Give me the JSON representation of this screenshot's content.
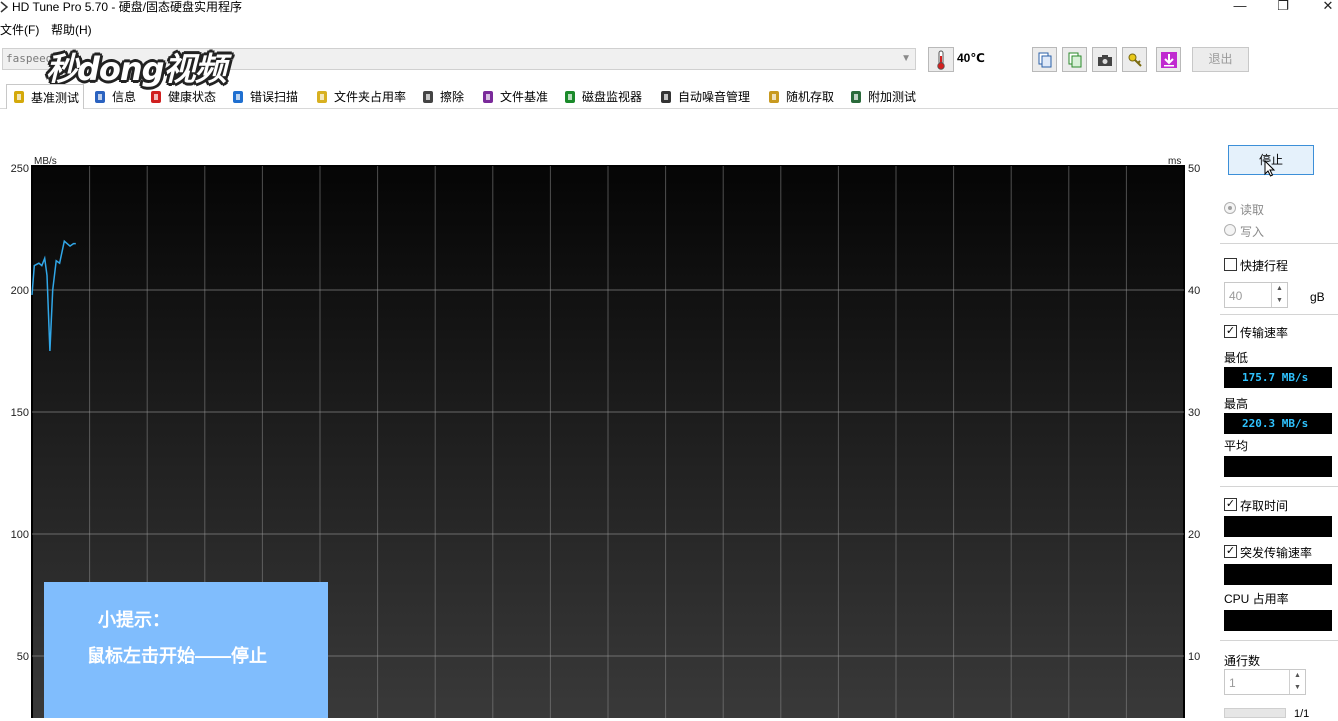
{
  "window": {
    "title": "HD Tune Pro 5.70 - 硬盘/固态硬盘实用程序",
    "minimize": "—",
    "restore": "❐",
    "close": "✕"
  },
  "menu": {
    "file": "文件(F)",
    "help": "帮助(H)"
  },
  "drive": {
    "selected": "faspeed"
  },
  "temperature": "40℃",
  "toolbar": {
    "exit_label": "退出"
  },
  "watermark": {
    "text": "秒dong视频"
  },
  "tabs": [
    {
      "label": "基准测试",
      "icon": "benchmark-icon",
      "active": true
    },
    {
      "label": "信息",
      "icon": "info-icon"
    },
    {
      "label": "健康状态",
      "icon": "health-icon"
    },
    {
      "label": "错误扫描",
      "icon": "error-scan-icon"
    },
    {
      "label": "文件夹占用率",
      "icon": "folder-usage-icon"
    },
    {
      "label": "擦除",
      "icon": "erase-icon"
    },
    {
      "label": "文件基准",
      "icon": "file-benchmark-icon"
    },
    {
      "label": "磁盘监视器",
      "icon": "disk-monitor-icon"
    },
    {
      "label": "自动噪音管理",
      "icon": "noise-icon"
    },
    {
      "label": "随机存取",
      "icon": "random-access-icon"
    },
    {
      "label": "附加测试",
      "icon": "extra-tests-icon"
    }
  ],
  "chart_data": {
    "type": "line",
    "ylabel_left": "MB/s",
    "ylabel_right": "ms",
    "ylim_left": [
      0,
      250
    ],
    "ylim_right": [
      0,
      50
    ],
    "yticks_left": [
      50,
      100,
      150,
      200,
      250
    ],
    "yticks_right": [
      10,
      20,
      30,
      40,
      50
    ],
    "grid": true,
    "x_progress_pct": [
      0,
      0.2,
      0.6,
      0.85,
      1.1,
      1.3,
      1.55,
      1.8,
      2.1,
      2.4,
      2.8,
      3.3,
      3.6,
      3.8
    ],
    "series": [
      {
        "name": "",
        "color": "#31a7e8",
        "values": [
          198,
          210,
          211,
          210,
          213,
          206,
          175,
          200,
          212,
          211,
          220,
          218,
          219,
          219
        ]
      }
    ]
  },
  "hint": {
    "line1": "小提示：",
    "line2": "鼠标左击开始——停止"
  },
  "panel": {
    "stop_label": "停止",
    "read_label": "读取",
    "write_label": "写入",
    "short_stroke_label": "快捷行程",
    "short_stroke_value": "40",
    "short_stroke_unit": "gB",
    "transfer_rate_label": "传输速率",
    "min_label": "最低",
    "min_value": "175.7 MB/s",
    "max_label": "最高",
    "max_value": "220.3 MB/s",
    "avg_label": "平均",
    "access_time_label": "存取时间",
    "burst_rate_label": "突发传输速率",
    "cpu_label": "CPU 占用率",
    "passes_label": "通行数",
    "passes_value": "1",
    "pass_progress": "1/1"
  }
}
